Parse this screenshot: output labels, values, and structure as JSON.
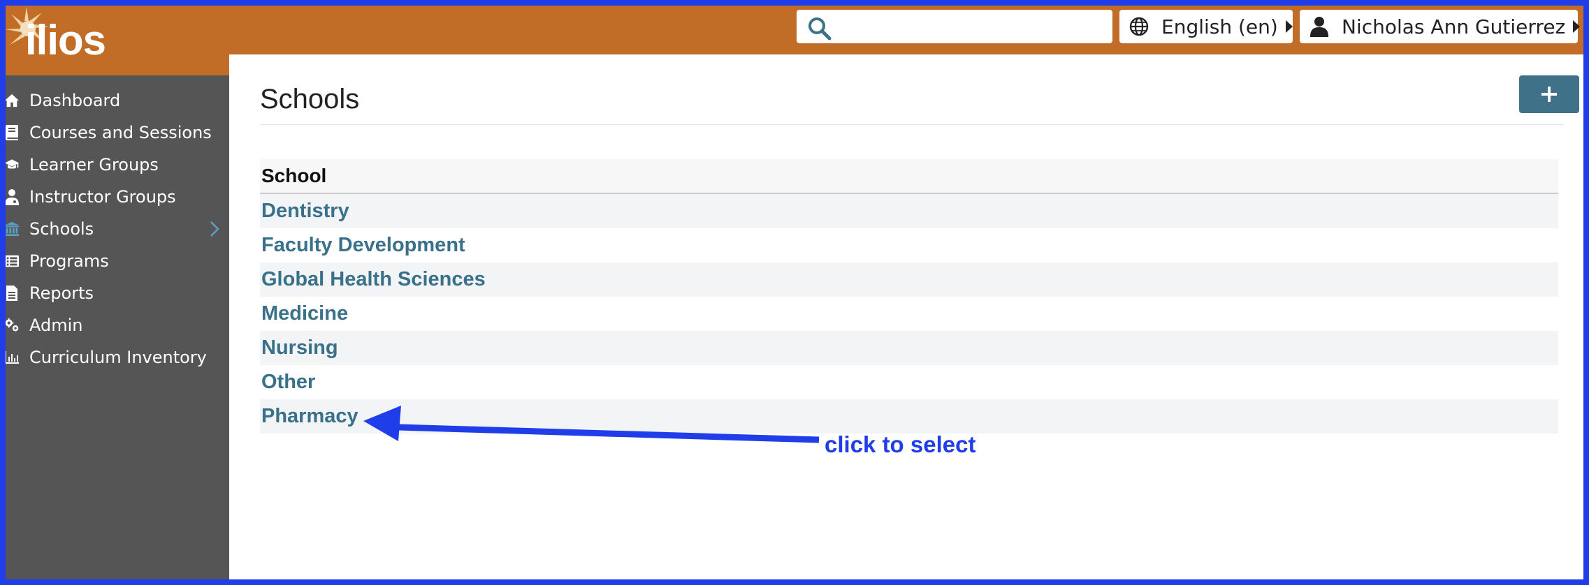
{
  "app": {
    "logo_text": "ilios"
  },
  "header": {
    "search": {
      "value": "",
      "placeholder": ""
    },
    "language_label": "English (en)",
    "user_label": "Nicholas Ann Gutierrez"
  },
  "sidebar": {
    "items": [
      {
        "label": "Dashboard",
        "icon": "home-icon"
      },
      {
        "label": "Courses and Sessions",
        "icon": "book-icon"
      },
      {
        "label": "Learner Groups",
        "icon": "graduation-cap-icon"
      },
      {
        "label": "Instructor Groups",
        "icon": "instructor-icon"
      },
      {
        "label": "Schools",
        "icon": "university-icon",
        "active": true
      },
      {
        "label": "Programs",
        "icon": "list-icon"
      },
      {
        "label": "Reports",
        "icon": "file-icon"
      },
      {
        "label": "Admin",
        "icon": "cogs-icon"
      },
      {
        "label": "Curriculum Inventory",
        "icon": "bar-chart-icon"
      }
    ]
  },
  "main": {
    "title": "Schools",
    "add_button_icon": "plus-icon",
    "table": {
      "header": "School",
      "rows": [
        "Dentistry",
        "Faculty Development",
        "Global Health Sciences",
        "Medicine",
        "Nursing",
        "Other",
        "Pharmacy"
      ]
    }
  },
  "annotation": {
    "text": "click to select"
  },
  "colors": {
    "border": "#1f3de8",
    "header": "#c26d27",
    "sidebar": "#555555",
    "link": "#39708a",
    "button": "#3f7289",
    "active_icon": "#5b9fc4",
    "annotation": "#1f3de8"
  }
}
